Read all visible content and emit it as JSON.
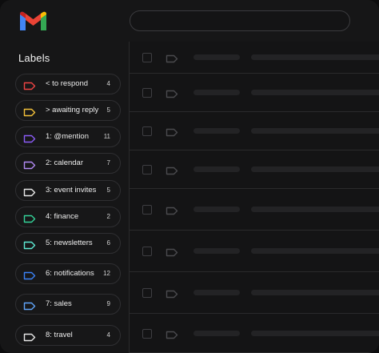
{
  "app": {
    "logo_icon": "gmail-logo",
    "search": {
      "placeholder": ""
    }
  },
  "sidebar": {
    "title": "Labels",
    "labels": [
      {
        "name": "< to respond",
        "count": "4",
        "color": "#ef4444"
      },
      {
        "name": "> awaiting reply",
        "count": "5",
        "color": "#f4c13a"
      },
      {
        "name": "1: @mention",
        "count": "11",
        "color": "#8b5cf6"
      },
      {
        "name": "2: calendar",
        "count": "7",
        "color": "#b18af3"
      },
      {
        "name": "3: event invites",
        "count": "5",
        "color": "#e8e8e8"
      },
      {
        "name": "4: finance",
        "count": "2",
        "color": "#34d399"
      },
      {
        "name": "5: newsletters",
        "count": "6",
        "color": "#5eead4"
      },
      {
        "name": "6: notifications",
        "count": "12",
        "color": "#3b82f6"
      },
      {
        "name": "7: sales",
        "count": "9",
        "color": "#60a5fa"
      },
      {
        "name": "8: travel",
        "count": "4",
        "color": "#e8e8e8"
      }
    ]
  },
  "main": {
    "row_count": 8,
    "placeholder_color": "#232325",
    "tag_icon_color": "#4a4a4e"
  }
}
